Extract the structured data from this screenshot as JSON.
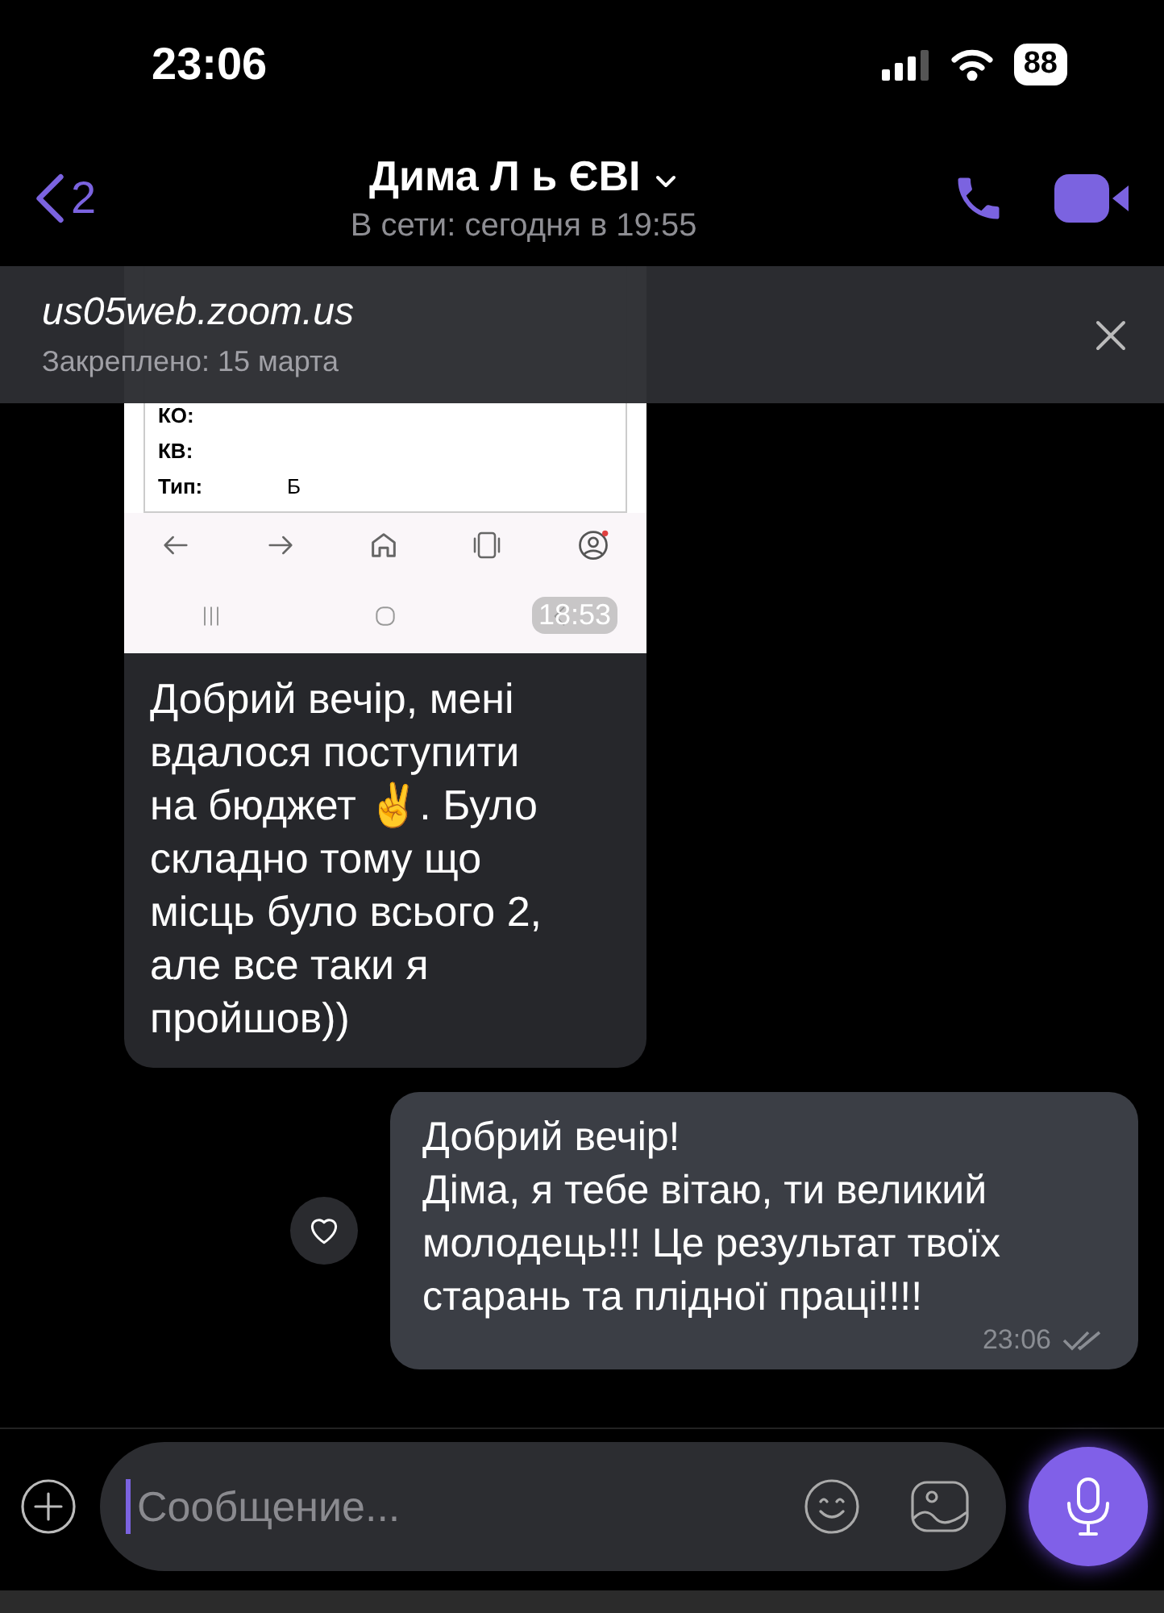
{
  "status_bar": {
    "time": "23:06",
    "battery": "88"
  },
  "header": {
    "back_count": "2",
    "title": "Дима Л  ь ЄВІ",
    "subtitle": "В сети: сегодня в 19:55"
  },
  "pinned": {
    "title": "us05web.zoom.us",
    "subtitle": "Закреплено: 15 марта"
  },
  "messages": [
    {
      "kind": "image_text",
      "screenshot": {
        "rows": [
          {
            "label": "КО:",
            "value": ""
          },
          {
            "label": "КВ:",
            "value": ""
          },
          {
            "label": "Тип:",
            "value": "Б"
          }
        ],
        "time": "18:53"
      },
      "text": "Добрий вечір, мені вдалося поступити на бюджет ✌️. Було складно тому що місць було всього 2, але все таки я пройшов))"
    },
    {
      "kind": "text",
      "text": "Добрий вечір!\nДіма, я тебе вітаю, ти великий молодець!!! Це результат твоїх старань та плідної праці!!!!",
      "time": "23:06",
      "read": true
    }
  ],
  "composer": {
    "placeholder": "Сообщение..."
  }
}
